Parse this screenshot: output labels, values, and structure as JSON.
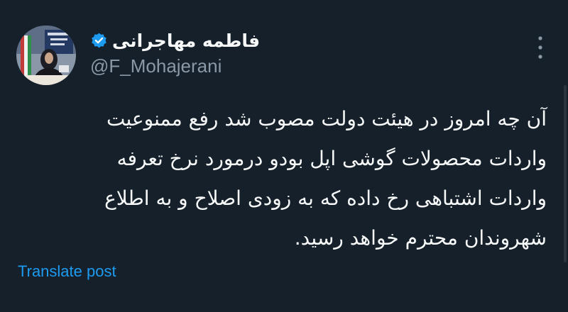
{
  "author": {
    "display_name": "فاطمه مهاجرانی",
    "handle": "@F_Mohajerani",
    "verified": true,
    "avatar_icon": "profile-photo"
  },
  "tweet": {
    "text": "آن چه امروز در هیئت دولت مصوب شد رفع ممنوعیت\nواردات محصولات گوشی اپل بودو درمورد نرخ تعرفه\nواردات اشتباهی رخ داده که به زودی اصلاح و به اطلاع\nشهروندان محترم خواهد رسید."
  },
  "actions": {
    "translate_label": "Translate post",
    "more_icon": "more-vertical-icon"
  },
  "colors": {
    "background": "#15202b",
    "text": "#f7f9f9",
    "secondary_text": "#8b98a5",
    "accent": "#1d9bf0"
  }
}
